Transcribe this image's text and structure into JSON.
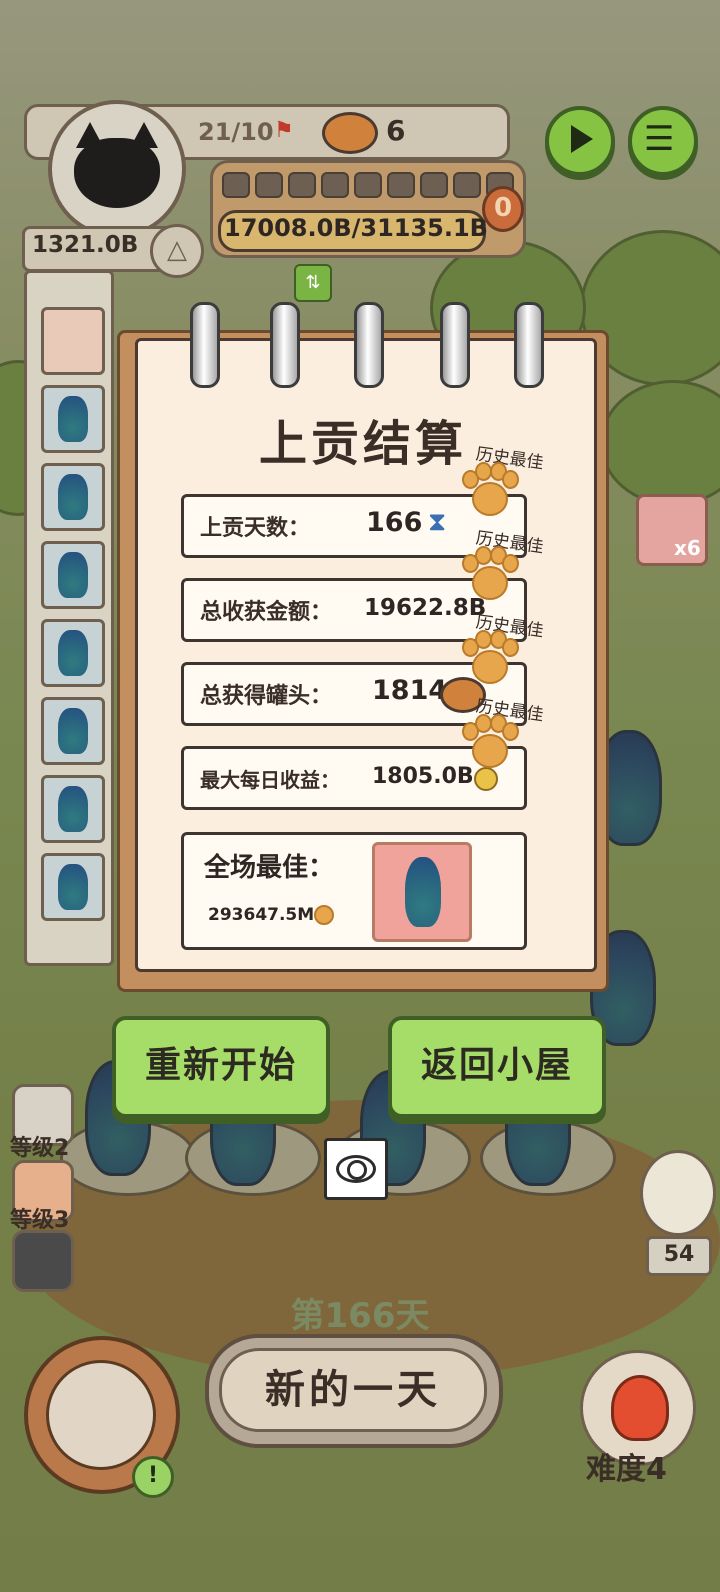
{
  "hud": {
    "level_progress": "21/10",
    "cans": "6",
    "money": "17008.0B/31135.1B",
    "side_money": "1321.0B",
    "red_badge": "0"
  },
  "modal": {
    "title": "上贡结算",
    "history_best": "历史最佳",
    "rows": [
      {
        "label": "上贡天数：",
        "value": "166"
      },
      {
        "label": "总收获金额：",
        "value": "19622.8B"
      },
      {
        "label": "总获得罐头：",
        "value": "1814"
      },
      {
        "label": "最大每日收益：",
        "value": "1805.0B"
      }
    ],
    "best": {
      "label": "全场最佳：",
      "value": "293647.5M"
    },
    "restart_label": "重新开始",
    "return_label": "返回小屋"
  },
  "side_item_multiplier": "x6",
  "counter_right": "54",
  "levels": [
    "等级2",
    "等级3"
  ],
  "day_label": "第166天",
  "new_day_label": "新的一天",
  "difficulty_label": "难度4"
}
